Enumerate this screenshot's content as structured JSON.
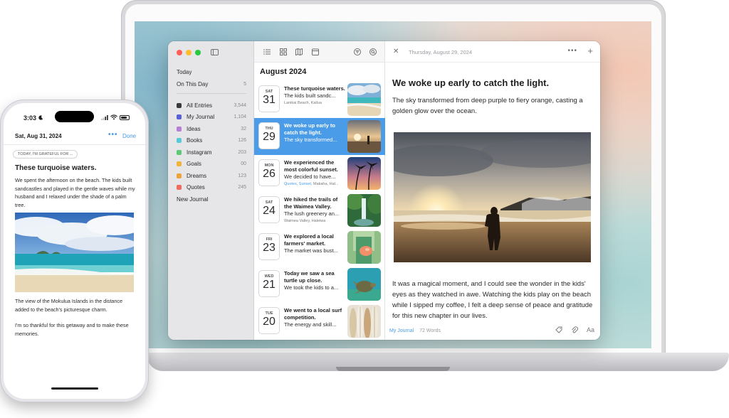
{
  "sidebar": {
    "nav": [
      {
        "label": "Today",
        "count": ""
      },
      {
        "label": "On This Day",
        "count": "5"
      }
    ],
    "journals": [
      {
        "label": "All Entries",
        "count": "3,544",
        "color": "#3a3a3c"
      },
      {
        "label": "My Journal",
        "count": "1,104",
        "color": "#5a5fd6"
      },
      {
        "label": "Ideas",
        "count": "32",
        "color": "#b77ed8"
      },
      {
        "label": "Books",
        "count": "126",
        "color": "#58c9d6"
      },
      {
        "label": "Instagram",
        "count": "203",
        "color": "#5fc874"
      },
      {
        "label": "Goals",
        "count": "00",
        "color": "#f2b33d"
      },
      {
        "label": "Dreams",
        "count": "123",
        "color": "#f0a23a"
      },
      {
        "label": "Quotes",
        "count": "245",
        "color": "#ef6b5e"
      }
    ],
    "new_journal": "New Journal"
  },
  "list": {
    "month": "August 2024",
    "entries": [
      {
        "dow": "SAT",
        "day": "31",
        "title": "These turquoise waters.",
        "snippet": "The kids built sandc...",
        "meta": "Lanikai Beach, Kailua",
        "meta_tags": ""
      },
      {
        "dow": "THU",
        "day": "29",
        "title": "We woke up early to catch the light.",
        "snippet": "The sky transformed...",
        "meta": "",
        "meta_tags": ""
      },
      {
        "dow": "MON",
        "day": "26",
        "title": "We experienced the most colorful sunset.",
        "snippet": "We decided to have...",
        "meta": "Makaha, Hal...",
        "meta_tags": "Quotes, Sunset,"
      },
      {
        "dow": "SAT",
        "day": "24",
        "title": "We hiked the  trails of the Waimea Valley.",
        "snippet": "The lush greenery an...",
        "meta": "Waimea Valley, Haleiwa",
        "meta_tags": ""
      },
      {
        "dow": "FRI",
        "day": "23",
        "title": "We explored a local farmers' market.",
        "snippet": "The market was bust...",
        "meta": "",
        "meta_tags": ""
      },
      {
        "dow": "WED",
        "day": "21",
        "title": "Today we saw a sea turtle up close.",
        "snippet": "We took the kids to a...",
        "meta": "",
        "meta_tags": ""
      },
      {
        "dow": "TUE",
        "day": "20",
        "title": "We went to a local surf competition.",
        "snippet": "The energy and skill...",
        "meta": "",
        "meta_tags": ""
      }
    ]
  },
  "detail": {
    "date": "Thursday, August 29, 2024",
    "more": "•••",
    "plus": "+",
    "close": "✕",
    "title": "We woke up early to catch the light.",
    "intro": "The sky transformed from deep purple to fiery orange, casting a golden glow over the ocean.",
    "body": "It was a magical moment, and I could see the wonder in the kids' eyes as they watched in awe. Watching the kids play on the beach while I sipped my coffee, I felt a deep sense of peace and gratitude for this new chapter in our lives.",
    "journal": "My Journal",
    "words": "72 Words",
    "format_label": "Aa"
  },
  "phone": {
    "time": "3:03",
    "date": "Sat, Aug 31, 2024",
    "more": "•••",
    "done": "Done",
    "prompt": "TODAY, I'M GRATEFUL FOR ...",
    "title": "These turquoise waters.",
    "p1": "We spent the afternoon on the beach. The kids built sandcastles and played in the gentle waves while my husband and I relaxed under the shade of a palm tree.",
    "p2": "The view of the Mokulua Islands in the distance added to the beach's picturesque charm.",
    "p3": "I'm so thankful for this getaway and to make these memories."
  },
  "colors": {
    "accent": "#4a9be8",
    "selected_row": "#4a9be8"
  }
}
